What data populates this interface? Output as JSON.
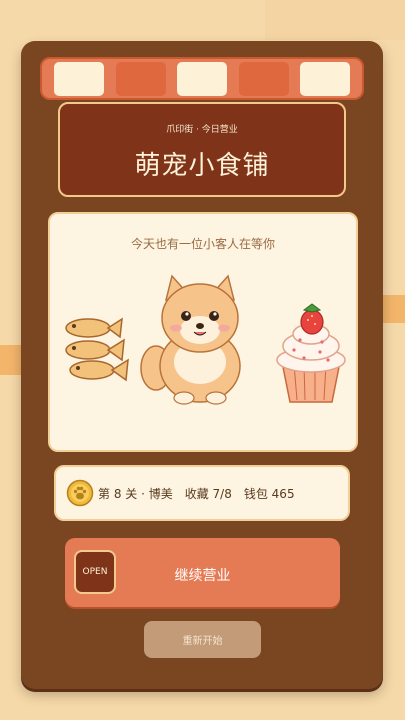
{
  "sign": {
    "subtitle": "爪印街 · 今日营业",
    "title": "萌宠小食铺"
  },
  "stage": {
    "message": "今天也有一位小客人在等你",
    "left_item": "fish-snacks",
    "pet": "pomeranian",
    "right_item": "strawberry-cupcake"
  },
  "status": {
    "level": "第 8 关 · 博美",
    "collection": "收藏 7/8",
    "wallet": "钱包 465"
  },
  "continue_button": {
    "badge": "OPEN",
    "label": "继续营业"
  },
  "restart_button": {
    "label": "重新开始"
  },
  "colors": {
    "wood": "#7a4521",
    "accent": "#e57b55",
    "cream": "#fdf4e1",
    "sign": "#7f3419"
  }
}
